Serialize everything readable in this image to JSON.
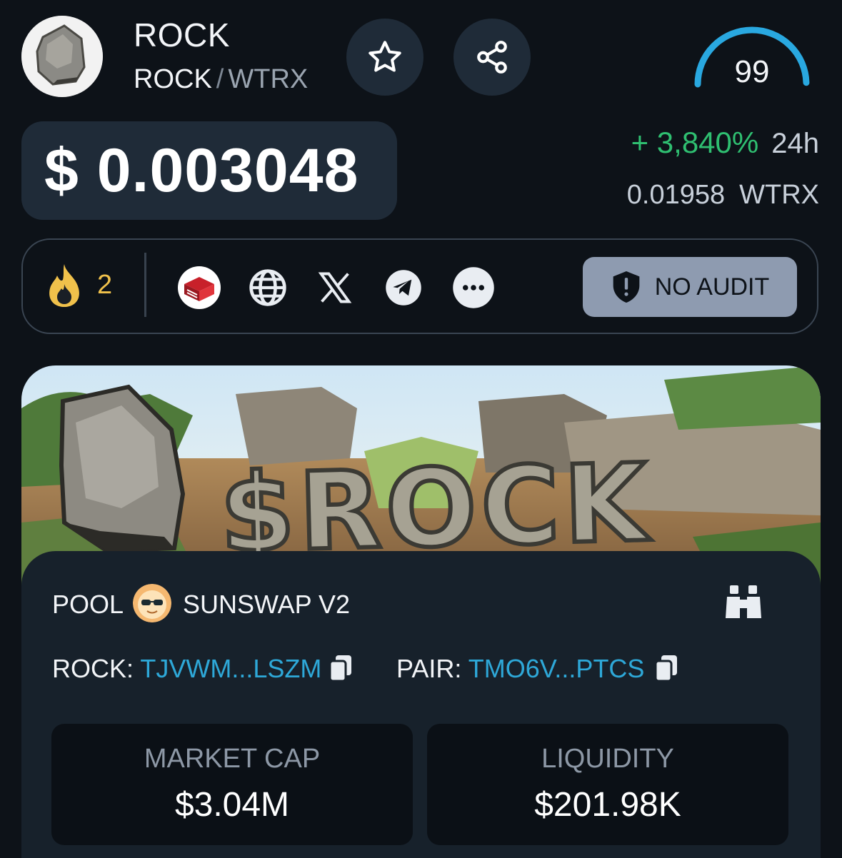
{
  "token": {
    "name": "ROCK",
    "symbol": "ROCK",
    "quote": "WTRX",
    "score": "99",
    "score_fraction": 0.99
  },
  "price": {
    "usd": "$ 0.003048",
    "change_pct": "+ 3,840%",
    "change_period": "24h",
    "native_value": "0.01958",
    "native_unit": "WTRX"
  },
  "social": {
    "boost_count": "2",
    "links": [
      "exchange-icon",
      "globe-icon",
      "x-icon",
      "telegram-icon",
      "more-icon"
    ],
    "audit_label": "NO AUDIT"
  },
  "banner": {
    "text": "$ROCK"
  },
  "pool": {
    "label": "POOL",
    "dex_name": "SUNSWAP V2",
    "token_addr_label": "ROCK:",
    "token_addr": "TJVWM...LSZM",
    "pair_addr_label": "PAIR:",
    "pair_addr": "TMO6V...PTCS"
  },
  "stats": {
    "market_cap_label": "MARKET CAP",
    "market_cap_value": "$3.04M",
    "liquidity_label": "LIQUIDITY",
    "liquidity_value": "$201.98K"
  },
  "colors": {
    "background": "#0d1218",
    "positive": "#2fbf71",
    "link": "#2ea8d8",
    "gauge": "#29a8e0",
    "boost": "#f0c14b"
  }
}
